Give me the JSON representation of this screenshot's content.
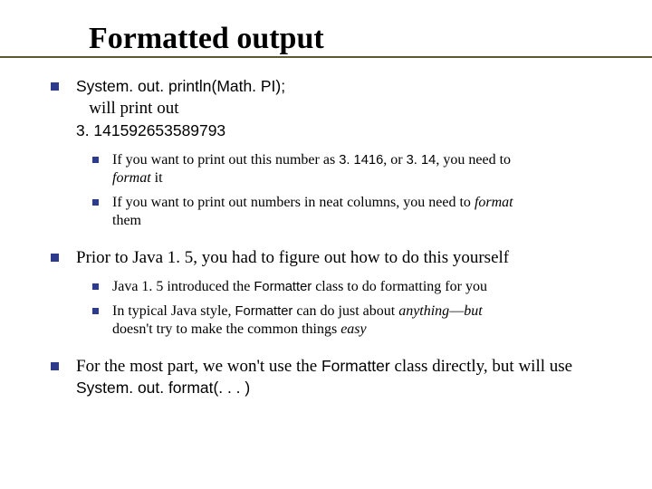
{
  "title": "Formatted output",
  "b1": {
    "line1_code": "System. out. println(Math. PI);",
    "line2_pre": "   will print out",
    "line3_code": "3. 141592653589793",
    "sub": [
      {
        "pre": "If you want to print out this number as ",
        "c1": "3. 1416",
        "mid": ", or ",
        "c2": "3. 14",
        "post1": ", you need to ",
        "ital": "format",
        "post2": " it"
      },
      {
        "pre": "If you want to print out numbers in neat columns, you need to ",
        "ital": "format",
        "post": " them"
      }
    ]
  },
  "b2": {
    "text": "Prior to Java 1. 5, you had to figure out how to do this yourself",
    "sub": [
      {
        "pre": "Java 1. 5 introduced the ",
        "code": "Formatter",
        "post": " class to do formatting for you"
      },
      {
        "pre": "In typical Java style, ",
        "code": "Formatter",
        "mid": " can do just about ",
        "ital1": "anything",
        "dash": "—",
        "ital2": "but",
        "line2_pre": "doesn't try to make the common things ",
        "ital3": "easy"
      }
    ]
  },
  "b3": {
    "pre": "For the most part, we won't use the ",
    "code1": "Formatter",
    "mid": " class directly, but will use ",
    "code2": "System. out. format(. . . )"
  }
}
